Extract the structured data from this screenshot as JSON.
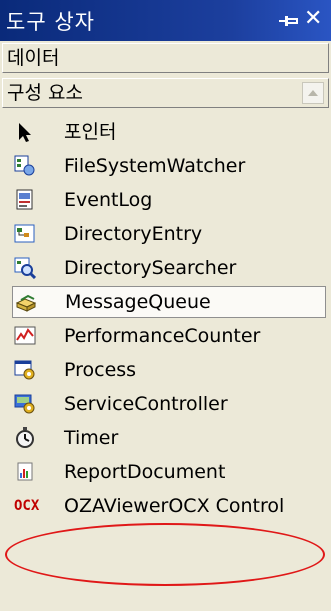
{
  "window": {
    "title": "도구 상자",
    "pin_icon": "pin-icon",
    "close_label": "✕"
  },
  "tabs": [
    {
      "label": "데이터"
    },
    {
      "label": "구성 요소"
    }
  ],
  "items": [
    {
      "label": "포인터",
      "icon": "pointer-icon"
    },
    {
      "label": "FileSystemWatcher",
      "icon": "filesystemwatcher-icon"
    },
    {
      "label": "EventLog",
      "icon": "eventlog-icon"
    },
    {
      "label": "DirectoryEntry",
      "icon": "directoryentry-icon"
    },
    {
      "label": "DirectorySearcher",
      "icon": "directorysearcher-icon"
    },
    {
      "label": "MessageQueue",
      "icon": "messagequeue-icon",
      "selected": true
    },
    {
      "label": "PerformanceCounter",
      "icon": "performancecounter-icon"
    },
    {
      "label": "Process",
      "icon": "process-icon"
    },
    {
      "label": "ServiceController",
      "icon": "servicecontroller-icon"
    },
    {
      "label": "Timer",
      "icon": "timer-icon"
    },
    {
      "label": "ReportDocument",
      "icon": "reportdocument-icon"
    },
    {
      "label": "OZAViewerOCX Control",
      "icon": "ocx-icon",
      "icon_text": "OCX",
      "highlighted": true
    }
  ],
  "colors": {
    "title_bg": "#0a246a",
    "panel_bg": "#ece9d8",
    "highlight_oval": "#e01818",
    "ocx_text": "#c00000"
  }
}
